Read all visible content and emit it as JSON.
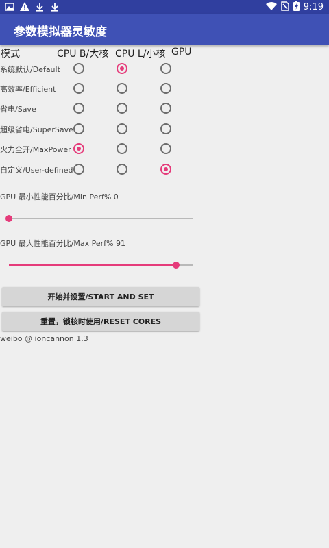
{
  "status_bar": {
    "time": "9:19",
    "left_icons": [
      "image-icon",
      "warning-icon",
      "download-icon",
      "download-icon"
    ],
    "right_icons": [
      "wifi-icon",
      "no-sim-icon",
      "battery-charging-icon"
    ]
  },
  "app_bar": {
    "title": "参数模拟器灵敏度"
  },
  "table": {
    "headers": {
      "mode": "模式",
      "cpu_b": "CPU B/大核",
      "cpu_l": "CPU L/小核",
      "gpu": "GPU"
    },
    "rows": [
      {
        "label": "系统默认/Default",
        "cpu_b": false,
        "cpu_l": true,
        "gpu": false
      },
      {
        "label": "高效率/Efficient",
        "cpu_b": false,
        "cpu_l": false,
        "gpu": false
      },
      {
        "label": "省电/Save",
        "cpu_b": false,
        "cpu_l": false,
        "gpu": false
      },
      {
        "label": "超级省电/SuperSave",
        "cpu_b": false,
        "cpu_l": false,
        "gpu": false
      },
      {
        "label": "火力全开/MaxPower",
        "cpu_b": true,
        "cpu_l": false,
        "gpu": false
      },
      {
        "label": "自定义/User-defined",
        "cpu_b": false,
        "cpu_l": false,
        "gpu": true
      }
    ]
  },
  "gpu_min": {
    "label": "GPU 最小性能百分比/Min Perf% 0",
    "value": 0
  },
  "gpu_max": {
    "label": "GPU 最大性能百分比/Max Perf% 91",
    "value": 91
  },
  "buttons": {
    "start": "开始并设置/START AND SET",
    "reset": "重置，锁核时使用/RESET CORES"
  },
  "footer": "weibo @ ioncannon 1.3",
  "colors": {
    "accent": "#e53b7a",
    "primary": "#3f51b5",
    "primary_dark": "#303f9f"
  }
}
